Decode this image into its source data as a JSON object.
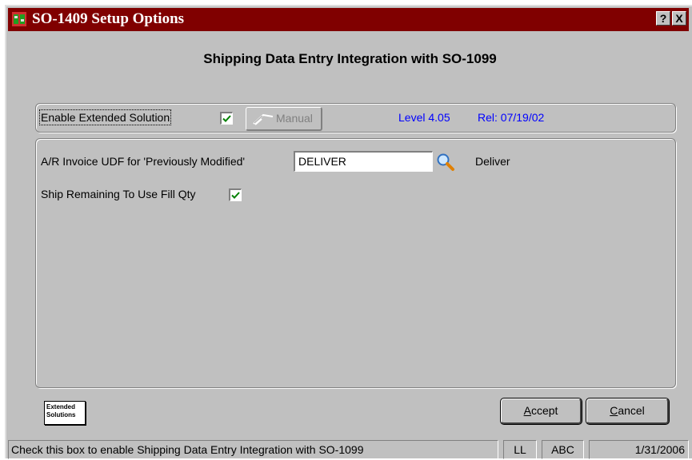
{
  "window": {
    "title": "SO-1409 Setup Options",
    "help_button": "?",
    "close_button": "X"
  },
  "heading": "Shipping Data Entry Integration with SO-1099",
  "top_group": {
    "enable_label": "Enable Extended Solution",
    "enable_checked": true,
    "manual_label": "Manual",
    "level": "Level 4.05",
    "release": "Rel: 07/19/02"
  },
  "options": {
    "udf_label": "A/R Invoice UDF for 'Previously Modified'",
    "udf_value": "DELIVER",
    "udf_description": "Deliver",
    "ship_remaining_label": "Ship Remaining To Use Fill Qty",
    "ship_remaining_checked": true
  },
  "logo": {
    "line1": "Extended",
    "line2": "Solutions"
  },
  "buttons": {
    "accept_hotkey": "A",
    "accept_rest": "ccept",
    "cancel_hotkey": "C",
    "cancel_rest": "ancel"
  },
  "statusbar": {
    "message": "Check this box to enable Shipping Data Entry Integration with SO-1099",
    "cell1": "LL",
    "cell2": "ABC",
    "date": "1/31/2006"
  },
  "colors": {
    "titlebar": "#800000",
    "check": "#008000",
    "info_text": "#0000ff"
  },
  "icons": [
    "app-icon",
    "help-icon",
    "close-icon",
    "checkmark-icon",
    "lookup-magnifier-icon",
    "manual-book-icon"
  ]
}
